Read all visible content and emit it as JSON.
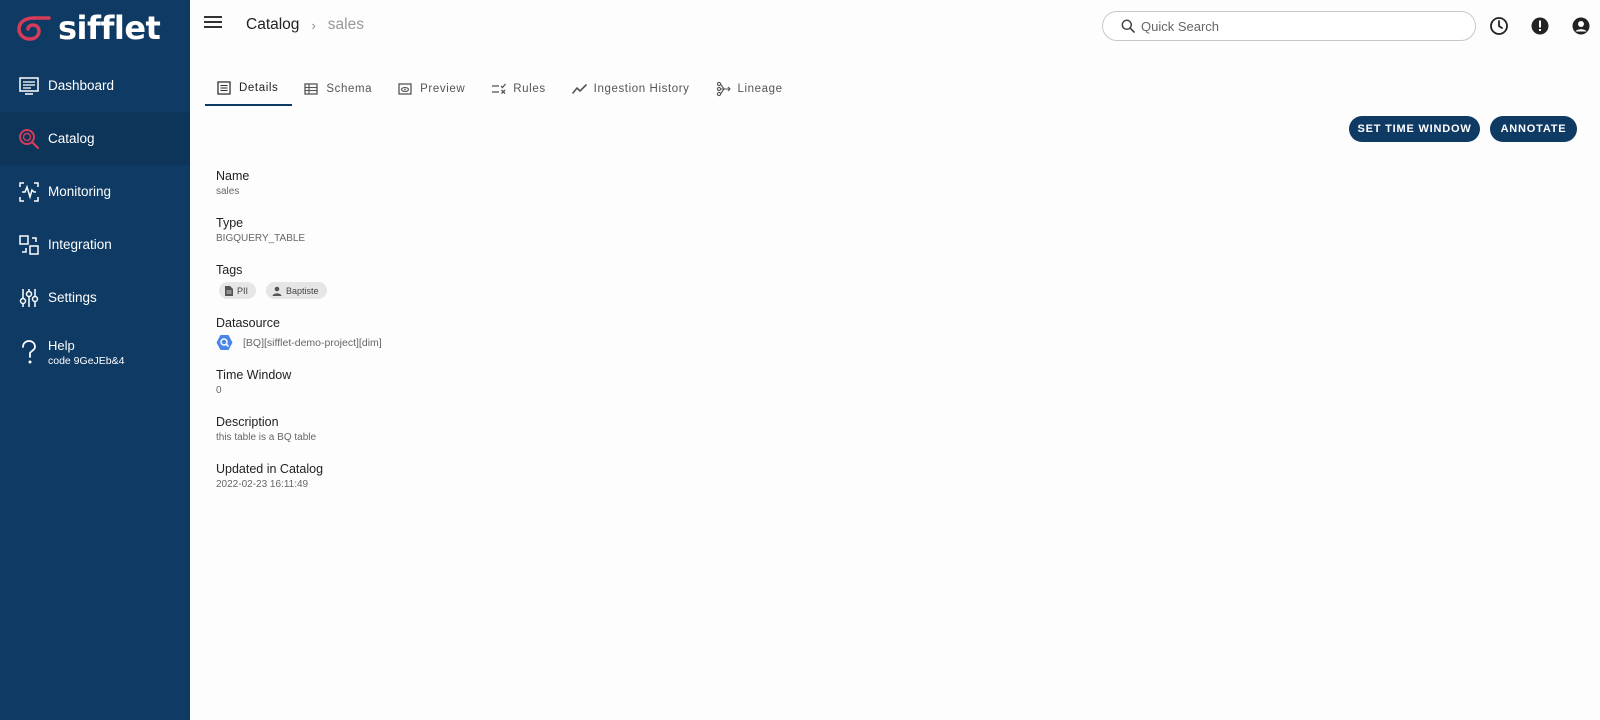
{
  "app": {
    "name": "sifflet",
    "brand_color": "#0f3a63",
    "accent_color": "#d43c5a"
  },
  "sidebar": {
    "items": [
      {
        "label": "Dashboard",
        "icon": "dashboard-icon"
      },
      {
        "label": "Catalog",
        "icon": "catalog-search-icon",
        "active": true
      },
      {
        "label": "Monitoring",
        "icon": "monitoring-icon"
      },
      {
        "label": "Integration",
        "icon": "integration-icon"
      },
      {
        "label": "Settings",
        "icon": "settings-sliders-icon"
      }
    ],
    "help": {
      "label": "Help",
      "code": "code 9GeJEb&4",
      "icon": "help-icon"
    }
  },
  "header": {
    "breadcrumb": {
      "root": "Catalog",
      "separator": "›",
      "current": "sales"
    },
    "search": {
      "placeholder": "Quick Search"
    },
    "icons": [
      "history-icon",
      "alert-icon",
      "account-icon"
    ]
  },
  "tabs": [
    {
      "label": "Details",
      "icon": "details-icon",
      "active": true
    },
    {
      "label": "Schema",
      "icon": "schema-icon"
    },
    {
      "label": "Preview",
      "icon": "preview-icon"
    },
    {
      "label": "Rules",
      "icon": "rules-icon"
    },
    {
      "label": "Ingestion History",
      "icon": "trend-icon"
    },
    {
      "label": "Lineage",
      "icon": "lineage-icon"
    }
  ],
  "actions": {
    "set_time_window": "SET TIME WINDOW",
    "annotate": "ANNOTATE"
  },
  "details": {
    "name": {
      "label": "Name",
      "value": "sales"
    },
    "type": {
      "label": "Type",
      "value": "BIGQUERY_TABLE"
    },
    "tags": {
      "label": "Tags",
      "items": [
        {
          "label": "PII",
          "icon": "document-icon"
        },
        {
          "label": "Baptiste",
          "icon": "person-icon"
        }
      ]
    },
    "datasource": {
      "label": "Datasource",
      "value": "[BQ][sifflet-demo-project][dim]",
      "icon": "bigquery-icon"
    },
    "time_window": {
      "label": "Time Window",
      "value": "0"
    },
    "description": {
      "label": "Description",
      "value": "this table is a BQ table"
    },
    "updated": {
      "label": "Updated in Catalog",
      "value": "2022-02-23 16:11:49"
    }
  }
}
